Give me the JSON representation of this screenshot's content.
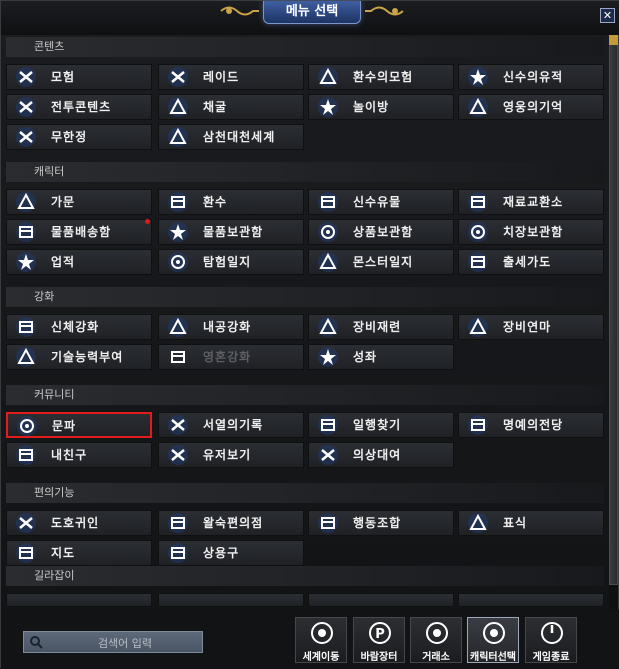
{
  "window": {
    "title": "메뉴 선택",
    "close_label": "✕"
  },
  "sections": [
    {
      "label": "콘텐츠",
      "items": [
        {
          "label": "모험",
          "icon": "adventure-icon"
        },
        {
          "label": "레이드",
          "icon": "raid-icon"
        },
        {
          "label": "환수의모험",
          "icon": "spirit-adventure-icon"
        },
        {
          "label": "신수의유적",
          "icon": "divine-beast-ruins-icon"
        },
        {
          "label": "전투콘텐츠",
          "icon": "crossed-swords-icon"
        },
        {
          "label": "채굴",
          "icon": "mining-icon"
        },
        {
          "label": "놀이방",
          "icon": "playroom-icon"
        },
        {
          "label": "영웅의기억",
          "icon": "hero-memory-icon"
        },
        {
          "label": "무한정",
          "icon": "infinite-tower-icon"
        },
        {
          "label": "삼천대천세계",
          "icon": "three-thousand-worlds-icon"
        }
      ]
    },
    {
      "label": "캐릭터",
      "items": [
        {
          "label": "가문",
          "icon": "family-tree-icon"
        },
        {
          "label": "환수",
          "icon": "spirit-beast-icon"
        },
        {
          "label": "신수유물",
          "icon": "divine-relic-icon"
        },
        {
          "label": "재료교환소",
          "icon": "material-exchange-icon"
        },
        {
          "label": "물품배송함",
          "icon": "delivery-box-icon",
          "badge": true
        },
        {
          "label": "물품보관함",
          "icon": "storage-chest-icon"
        },
        {
          "label": "상품보관함",
          "icon": "product-storage-icon"
        },
        {
          "label": "치장보관함",
          "icon": "costume-storage-icon"
        },
        {
          "label": "업적",
          "icon": "achievement-laurel-icon"
        },
        {
          "label": "탐험일지",
          "icon": "exploration-log-icon"
        },
        {
          "label": "몬스터일지",
          "icon": "monster-log-icon"
        },
        {
          "label": "출세가도",
          "icon": "success-path-icon"
        }
      ]
    },
    {
      "label": "강화",
      "items": [
        {
          "label": "신체강화",
          "icon": "body-enhance-icon"
        },
        {
          "label": "내공강화",
          "icon": "inner-power-icon"
        },
        {
          "label": "장비재련",
          "icon": "equipment-refine-icon"
        },
        {
          "label": "장비연마",
          "icon": "equipment-polish-icon"
        },
        {
          "label": "기술능력부여",
          "icon": "skill-grant-icon"
        },
        {
          "label": "영혼강화",
          "icon": "soul-enhance-icon",
          "disabled": true
        },
        {
          "label": "성좌",
          "icon": "constellation-icon"
        }
      ]
    },
    {
      "label": "커뮤니티",
      "items": [
        {
          "label": "문파",
          "icon": "guild-icon",
          "selected": true
        },
        {
          "label": "서열의기록",
          "icon": "ranking-record-icon"
        },
        {
          "label": "일행찾기",
          "icon": "party-finder-icon"
        },
        {
          "label": "명예의전당",
          "icon": "hall-of-fame-icon"
        },
        {
          "label": "내친구",
          "icon": "friends-icon"
        },
        {
          "label": "유저보기",
          "icon": "user-view-icon"
        },
        {
          "label": "의상대여",
          "icon": "costume-rental-icon"
        }
      ]
    },
    {
      "label": "편의기능",
      "items": [
        {
          "label": "도호귀인",
          "icon": "dohogwiin-icon"
        },
        {
          "label": "왈숙편의점",
          "icon": "convenience-store-icon"
        },
        {
          "label": "행동조합",
          "icon": "action-combo-icon"
        },
        {
          "label": "표식",
          "icon": "marker-icon"
        },
        {
          "label": "지도",
          "icon": "map-pin-icon"
        },
        {
          "label": "상용구",
          "icon": "phrases-icon"
        }
      ]
    },
    {
      "label": "길라잡이",
      "items": []
    }
  ],
  "search": {
    "placeholder": "검색어 입력"
  },
  "quick_buttons": [
    {
      "label": "세계이동",
      "icon": "globe-icon"
    },
    {
      "label": "바람장터",
      "icon": "market-p-icon"
    },
    {
      "label": "거래소",
      "icon": "scale-icon"
    },
    {
      "label": "캐릭터선택",
      "icon": "character-select-icon",
      "active": true
    },
    {
      "label": "게임종료",
      "icon": "power-icon"
    }
  ]
}
